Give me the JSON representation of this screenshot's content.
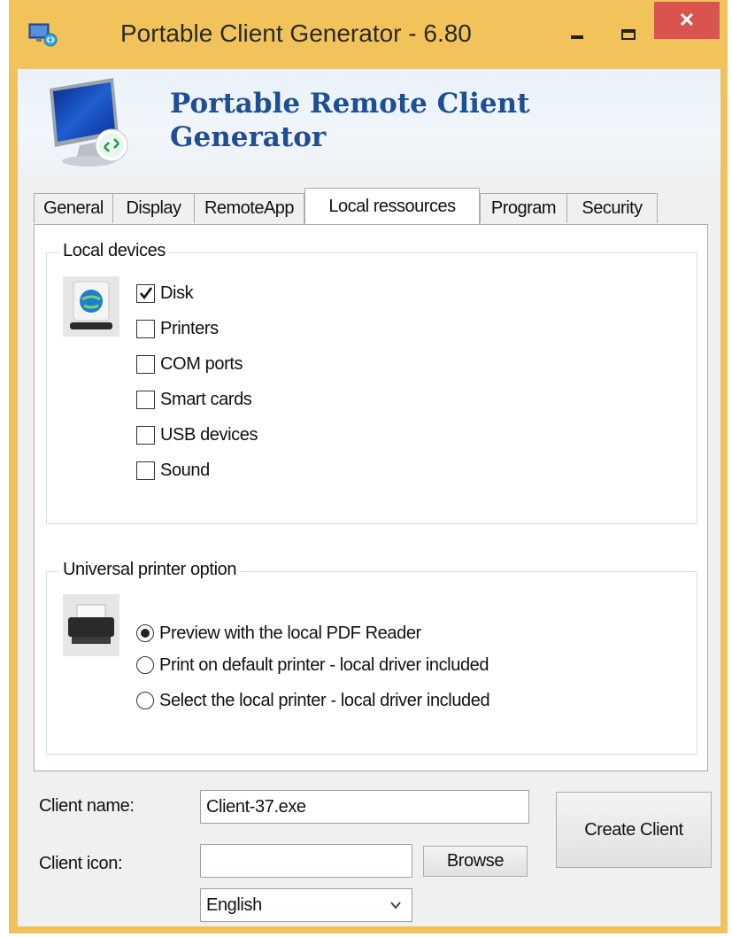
{
  "window": {
    "title": "Portable Client Generator - 6.80",
    "close_glyph": "✕",
    "icons": {
      "app": "remote-desktop-icon",
      "minimize": "minimize-icon",
      "maximize": "maximize-icon",
      "close": "close-icon"
    }
  },
  "banner": {
    "title_line1": "Portable Remote Client",
    "title_line2": "Generator",
    "icon": "remote-desktop-monitor-icon"
  },
  "tabs": [
    {
      "label": "General"
    },
    {
      "label": "Display"
    },
    {
      "label": "RemoteApp"
    },
    {
      "label": "Local ressources",
      "active": true
    },
    {
      "label": "Program"
    },
    {
      "label": "Security"
    }
  ],
  "local_devices": {
    "group_label": "Local devices",
    "icon": "network-drive-icon",
    "items": [
      {
        "label": "Disk",
        "checked": true
      },
      {
        "label": "Printers",
        "checked": false
      },
      {
        "label": "COM ports",
        "checked": false
      },
      {
        "label": "Smart cards",
        "checked": false
      },
      {
        "label": "USB devices",
        "checked": false
      },
      {
        "label": "Sound",
        "checked": false
      }
    ]
  },
  "printer_option": {
    "group_label": "Universal printer option",
    "icon": "printer-icon",
    "options": [
      {
        "label": "Preview with the local PDF Reader",
        "selected": true
      },
      {
        "label": "Print on default printer - local driver included",
        "selected": false
      },
      {
        "label": "Select the local printer - local driver included",
        "selected": false
      }
    ]
  },
  "footer": {
    "client_name_label": "Client name:",
    "client_name_value": "Client-37.exe",
    "client_icon_label": "Client icon:",
    "client_icon_value": "",
    "browse_label": "Browse",
    "language_value": "English",
    "create_label": "Create Client"
  },
  "colors": {
    "title_bar": "#f3c35b",
    "close_button": "#d9534f",
    "banner_title": "#1e4e93"
  }
}
